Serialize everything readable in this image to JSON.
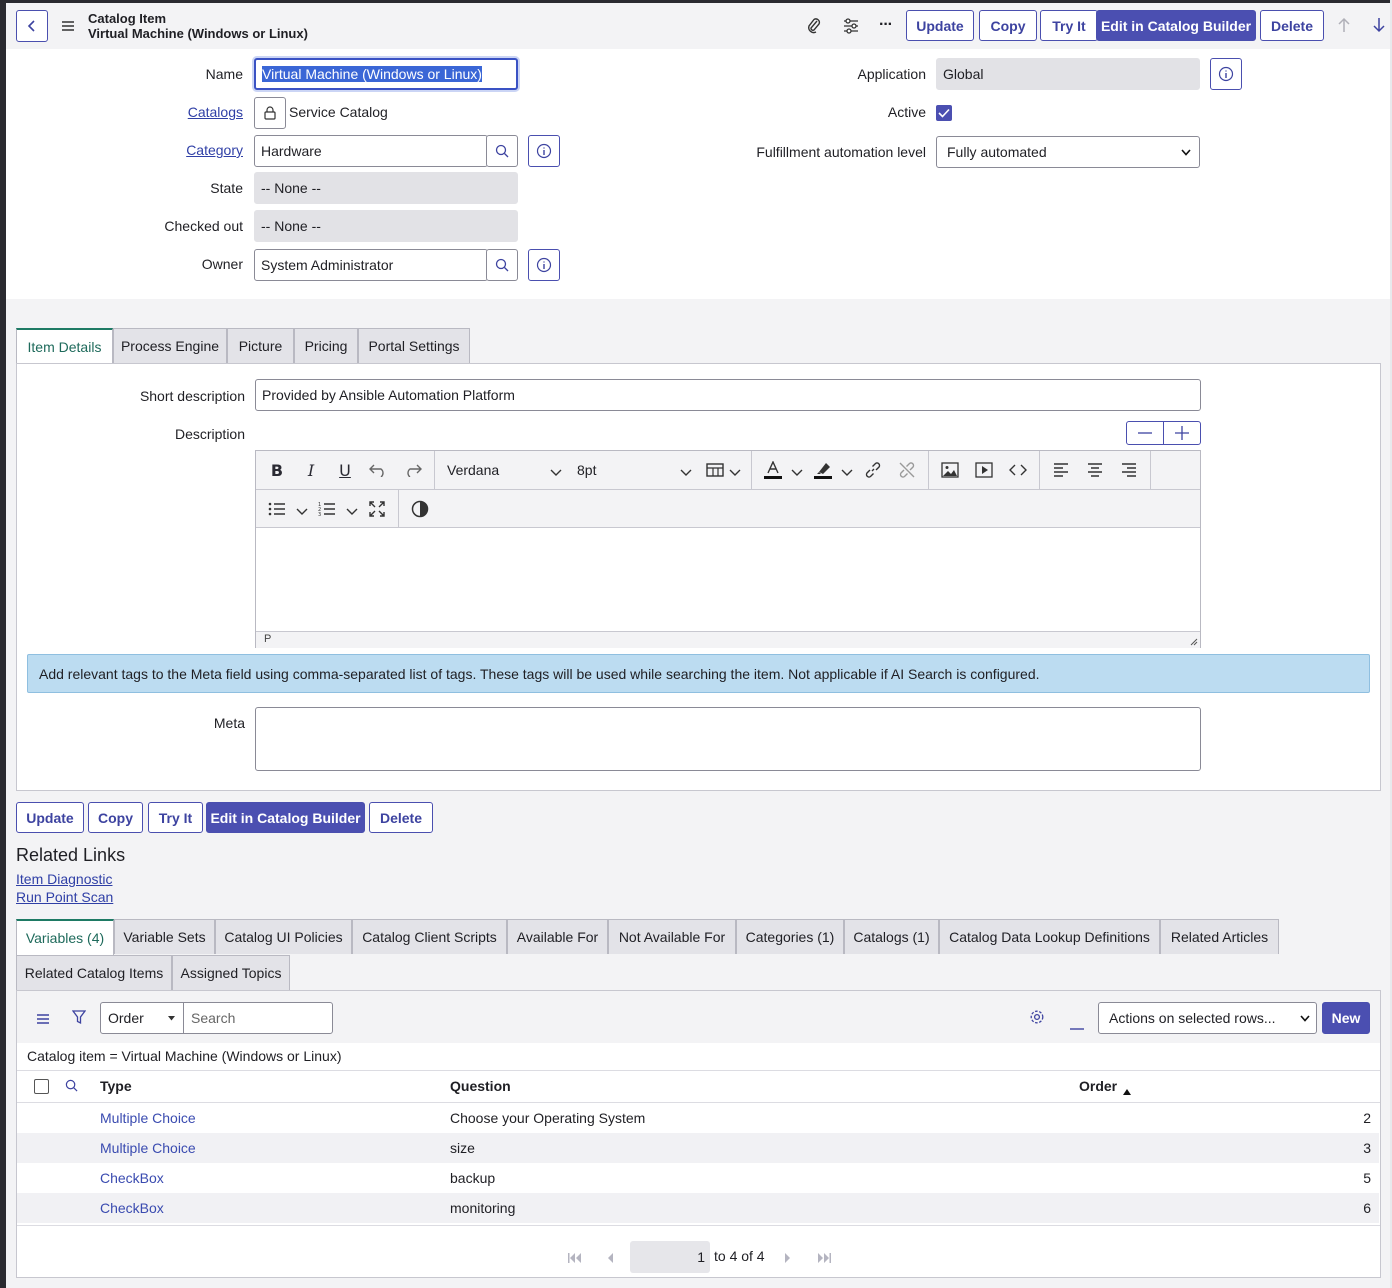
{
  "header": {
    "subtitle": "Catalog Item",
    "title": "Virtual Machine (Windows or Linux)",
    "buttons": {
      "update": "Update",
      "copy": "Copy",
      "try_it": "Try It",
      "edit_builder": "Edit in Catalog Builder",
      "delete": "Delete"
    }
  },
  "form": {
    "name_label": "Name",
    "name_value": "Virtual Machine (Windows or Linux)",
    "catalogs_label": "Catalogs",
    "catalogs_value": "Service Catalog",
    "category_label": "Category",
    "category_value": "Hardware",
    "state_label": "State",
    "state_value": "-- None --",
    "checked_out_label": "Checked out",
    "checked_out_value": "-- None --",
    "owner_label": "Owner",
    "owner_value": "System Administrator",
    "application_label": "Application",
    "application_value": "Global",
    "active_label": "Active",
    "active_checked": true,
    "fulfillment_label": "Fulfillment automation level",
    "fulfillment_value": "Fully automated"
  },
  "section_tabs": [
    "Item Details",
    "Process Engine",
    "Picture",
    "Pricing",
    "Portal Settings"
  ],
  "item_details": {
    "short_desc_label": "Short description",
    "short_desc_value": "Provided by Ansible Automation Platform",
    "description_label": "Description",
    "editor_font": "Verdana",
    "editor_size": "8pt",
    "editor_status": "P",
    "info_message": "Add relevant tags to the Meta field using comma-separated list of tags. These tags will be used while searching the item. Not applicable if AI Search is configured.",
    "meta_label": "Meta"
  },
  "bottom_buttons": {
    "update": "Update",
    "copy": "Copy",
    "try_it": "Try It",
    "edit_builder": "Edit in Catalog Builder",
    "delete": "Delete"
  },
  "related_links": {
    "title": "Related Links",
    "items": [
      "Item Diagnostic",
      "Run Point Scan"
    ]
  },
  "related_tabs_row1": [
    "Variables (4)",
    "Variable Sets",
    "Catalog UI Policies",
    "Catalog Client Scripts",
    "Available For",
    "Not Available For",
    "Categories (1)",
    "Catalogs (1)",
    "Catalog Data Lookup Definitions",
    "Related Articles"
  ],
  "related_tabs_row2": [
    "Related Catalog Items",
    "Assigned Topics"
  ],
  "list": {
    "search_field": "Order",
    "search_placeholder": "Search",
    "actions_value": "Actions on selected rows...",
    "new_label": "New",
    "breadcrumb": "Catalog item = Virtual Machine (Windows or Linux)",
    "columns": {
      "type": "Type",
      "question": "Question",
      "order": "Order"
    },
    "rows": [
      {
        "type": "Multiple Choice",
        "question": "Choose your Operating System",
        "order": "2"
      },
      {
        "type": "Multiple Choice",
        "question": "size",
        "order": "3"
      },
      {
        "type": "CheckBox",
        "question": "backup",
        "order": "5"
      },
      {
        "type": "CheckBox",
        "question": "monitoring",
        "order": "6"
      }
    ],
    "pager_page": "1",
    "pager_text": "to 4 of 4"
  },
  "colors": {
    "accent": "#4b4fb1",
    "tab_active": "#1e7a64",
    "info_bg": "#bcdcf1",
    "link": "#2f3fa6"
  }
}
